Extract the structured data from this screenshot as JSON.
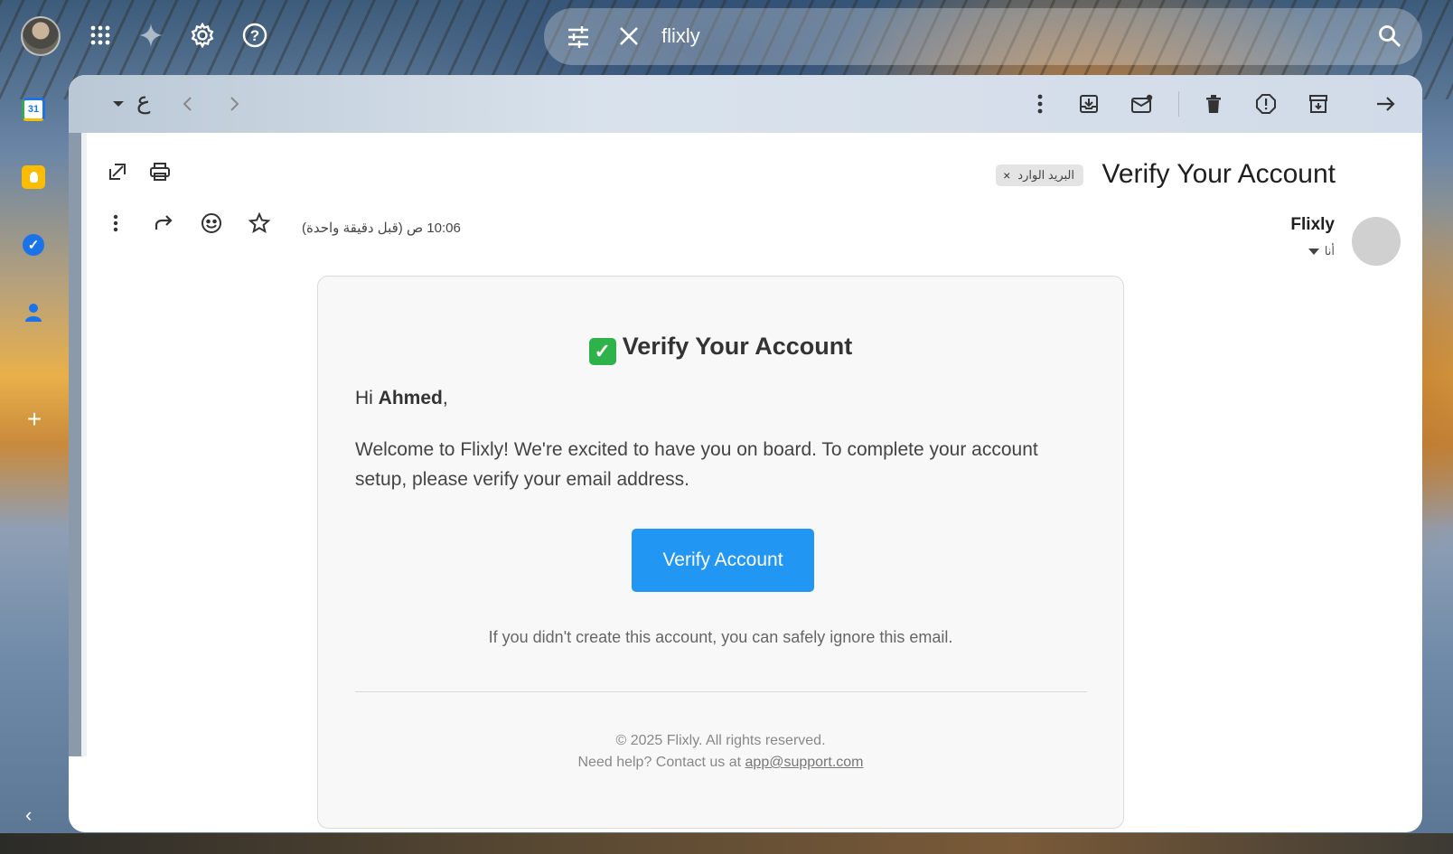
{
  "search": {
    "query": "flixly"
  },
  "toolbar": {
    "lang_indicator": "ع"
  },
  "email": {
    "subject": "Verify Your Account",
    "label_chip": "البريد الوارد",
    "label_remove": "×",
    "sender_name": "Flixly",
    "recipient": "أنا",
    "time": "10:06 ص (قبل دقيقة واحدة)"
  },
  "body": {
    "heading": "Verify Your Account",
    "greeting_prefix": "Hi ",
    "greeting_name": "Ahmed",
    "greeting_suffix": ",",
    "message": "Welcome to Flixly! We're excited to have you on board. To complete your account setup, please verify your email address.",
    "button_label": "Verify Account",
    "ignore_note": "If you didn't create this account, you can safely ignore this email.",
    "footer_copyright": "© 2025 Flixly. All rights reserved.",
    "footer_help_prefix": "Need help? Contact us at ",
    "footer_help_email": "app@support.com"
  },
  "rail": {
    "calendar_day": "31"
  },
  "colors": {
    "primary_button": "#2196f3",
    "check": "#2eb34a"
  }
}
